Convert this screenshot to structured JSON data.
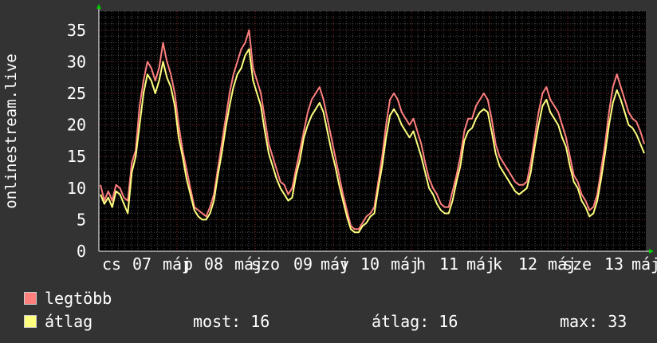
{
  "chart_data": {
    "type": "line",
    "ylabel": "onlinestream.live",
    "ylim": [
      0,
      38
    ],
    "yticks": [
      0,
      5,
      10,
      15,
      20,
      25,
      30,
      35
    ],
    "grid": true,
    "x_tick_labels": [
      "cs",
      "07",
      "máj",
      "p",
      "08",
      "máj",
      "szo",
      "09",
      "máj",
      "v",
      "10",
      "máj",
      "h",
      "11",
      "máj",
      "k",
      "12",
      "máj",
      "sze",
      "13",
      "máj"
    ],
    "series": [
      {
        "name": "legtöbb",
        "color": "#ff7f7f",
        "values": [
          10.5,
          8,
          9.5,
          8,
          10.5,
          10,
          8.5,
          8,
          14,
          16,
          23,
          27,
          30,
          29,
          27,
          29,
          33,
          30,
          28,
          25,
          20,
          16,
          13,
          10,
          7,
          6.5,
          6,
          5.5,
          7,
          9,
          13,
          17,
          21,
          25,
          28,
          30,
          32,
          33,
          35,
          29,
          27,
          25,
          21,
          17,
          15,
          13,
          11,
          10.5,
          9,
          10,
          13,
          16,
          19,
          22,
          24,
          25,
          26,
          24,
          21,
          18,
          15,
          12,
          9,
          6.5,
          4,
          3.5,
          3.5,
          4.5,
          5.5,
          6,
          7,
          11,
          15,
          20,
          24,
          25,
          24,
          22,
          21,
          20,
          21,
          19,
          17,
          14,
          11.5,
          10,
          9,
          7.5,
          7,
          7,
          9.5,
          12,
          15,
          19,
          21,
          21,
          23,
          24,
          25,
          24,
          21,
          17,
          15,
          14,
          13,
          12,
          11,
          10.5,
          10.5,
          11,
          14,
          18,
          22,
          25,
          26,
          24,
          23,
          22,
          20,
          18,
          15,
          12,
          11,
          9,
          8,
          6.5,
          7,
          9,
          13,
          17,
          22,
          26,
          28,
          26,
          24,
          22,
          21,
          20.5,
          19,
          17
        ]
      },
      {
        "name": "átlag",
        "color": "#ffff7f",
        "values": [
          9,
          7.5,
          8.5,
          7,
          9.5,
          9,
          7.5,
          6,
          12.5,
          15,
          20,
          25,
          28,
          27,
          25,
          27,
          30,
          27.5,
          26,
          23,
          18,
          15,
          11.5,
          9,
          6.5,
          5.5,
          5,
          5,
          6,
          8,
          12,
          15.5,
          19.5,
          23,
          26,
          28,
          29,
          31,
          32,
          27,
          25,
          23,
          19,
          15.5,
          13.5,
          11.5,
          10,
          9,
          8,
          8.5,
          12,
          14.5,
          18,
          20,
          21.5,
          22.5,
          23.5,
          22,
          19,
          16,
          13.5,
          10.5,
          8,
          5.5,
          3.5,
          3,
          3,
          4,
          4.5,
          5.5,
          6,
          10,
          13.5,
          18,
          21.5,
          22.5,
          21.5,
          20,
          19,
          18,
          19,
          17,
          15,
          12.5,
          10,
          9,
          7.5,
          6.5,
          6,
          6,
          8,
          11,
          13.5,
          17.5,
          19,
          19.5,
          21,
          22,
          22.5,
          22,
          19,
          15.5,
          13.5,
          12.5,
          11.5,
          10.5,
          9.5,
          9,
          9.5,
          10,
          12.5,
          16.5,
          20,
          23,
          24,
          22,
          21,
          20,
          18,
          16.5,
          13.5,
          11,
          10,
          8,
          7,
          5.5,
          6,
          8,
          11.5,
          15.5,
          20,
          23.5,
          25.5,
          24,
          22,
          20,
          19.5,
          18.5,
          17,
          15.5
        ]
      }
    ]
  },
  "legend": {
    "items": [
      {
        "label": "legtöbb",
        "color": "#ff7f7f"
      },
      {
        "label": "átlag",
        "color": "#ffff7f"
      }
    ]
  },
  "stats": {
    "now": "most: 16",
    "avg": "átlag: 16",
    "max": "max: 33"
  }
}
